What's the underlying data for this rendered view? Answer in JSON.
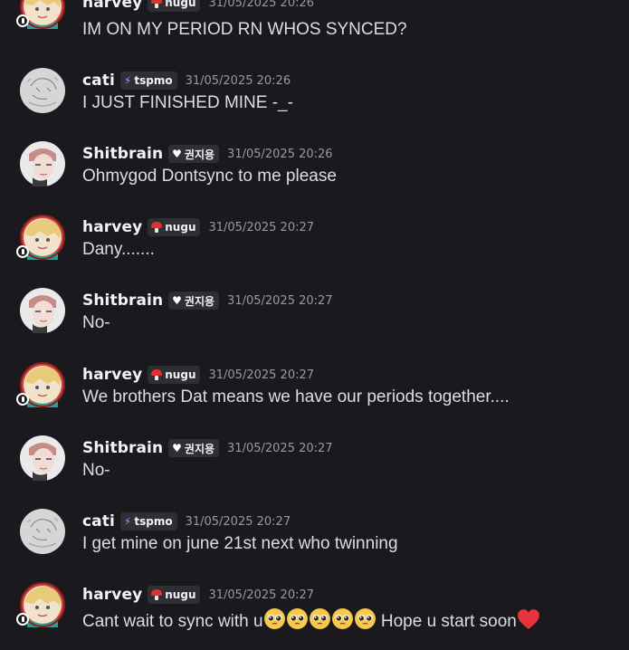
{
  "colors": {
    "background": "#1a1a1e",
    "username": "#f2f3f5",
    "timestamp": "#949ba4",
    "message_text": "#dbdee1",
    "tag_bg": "#2e2e34",
    "heart": "#e8323c"
  },
  "messages": [
    {
      "username": "harvey",
      "tag_icon": "mushroom-icon",
      "tag": "nugu",
      "timestamp": "31/05/2025 20:26",
      "text": "IM ON MY PERIOD RN WHOS SYNCED?",
      "avatar": "harvey-avatar"
    },
    {
      "username": "cati",
      "tag_icon": "lightning-icon",
      "tag": "tspmo",
      "timestamp": "31/05/2025 20:26",
      "text": "I JUST FINISHED MINE -_-",
      "avatar": "cati-avatar"
    },
    {
      "username": "Shitbrain",
      "tag_icon": "white-heart-icon",
      "tag": "권지용",
      "timestamp": "31/05/2025 20:26",
      "text": "Ohmygod Dontsync to me please",
      "avatar": "shitbrain-avatar"
    },
    {
      "username": "harvey",
      "tag_icon": "mushroom-icon",
      "tag": "nugu",
      "timestamp": "31/05/2025 20:27",
      "text": "Dany.......",
      "avatar": "harvey-avatar"
    },
    {
      "username": "Shitbrain",
      "tag_icon": "white-heart-icon",
      "tag": "권지용",
      "timestamp": "31/05/2025 20:27",
      "text": "No-",
      "avatar": "shitbrain-avatar"
    },
    {
      "username": "harvey",
      "tag_icon": "mushroom-icon",
      "tag": "nugu",
      "timestamp": "31/05/2025 20:27",
      "text": "We brothers Dat means we have our periods together....",
      "avatar": "harvey-avatar"
    },
    {
      "username": "Shitbrain",
      "tag_icon": "white-heart-icon",
      "tag": "권지용",
      "timestamp": "31/05/2025 20:27",
      "text": "No-",
      "avatar": "shitbrain-avatar"
    },
    {
      "username": "cati",
      "tag_icon": "lightning-icon",
      "tag": "tspmo",
      "timestamp": "31/05/2025 20:27",
      "text": "I get mine on june 21st  next who twinning",
      "avatar": "cati-avatar"
    },
    {
      "username": "harvey",
      "tag_icon": "mushroom-icon",
      "tag": "nugu",
      "timestamp": "31/05/2025 20:27",
      "text_before": "Cant wait to sync with u",
      "emojis": [
        "pleading-face-emoji",
        "pleading-face-emoji",
        "pleading-face-emoji",
        "pleading-face-emoji",
        "pleading-face-emoji"
      ],
      "text_after": " Hope u start soon",
      "trailing_emoji": "red-heart-emoji",
      "avatar": "harvey-avatar"
    }
  ]
}
